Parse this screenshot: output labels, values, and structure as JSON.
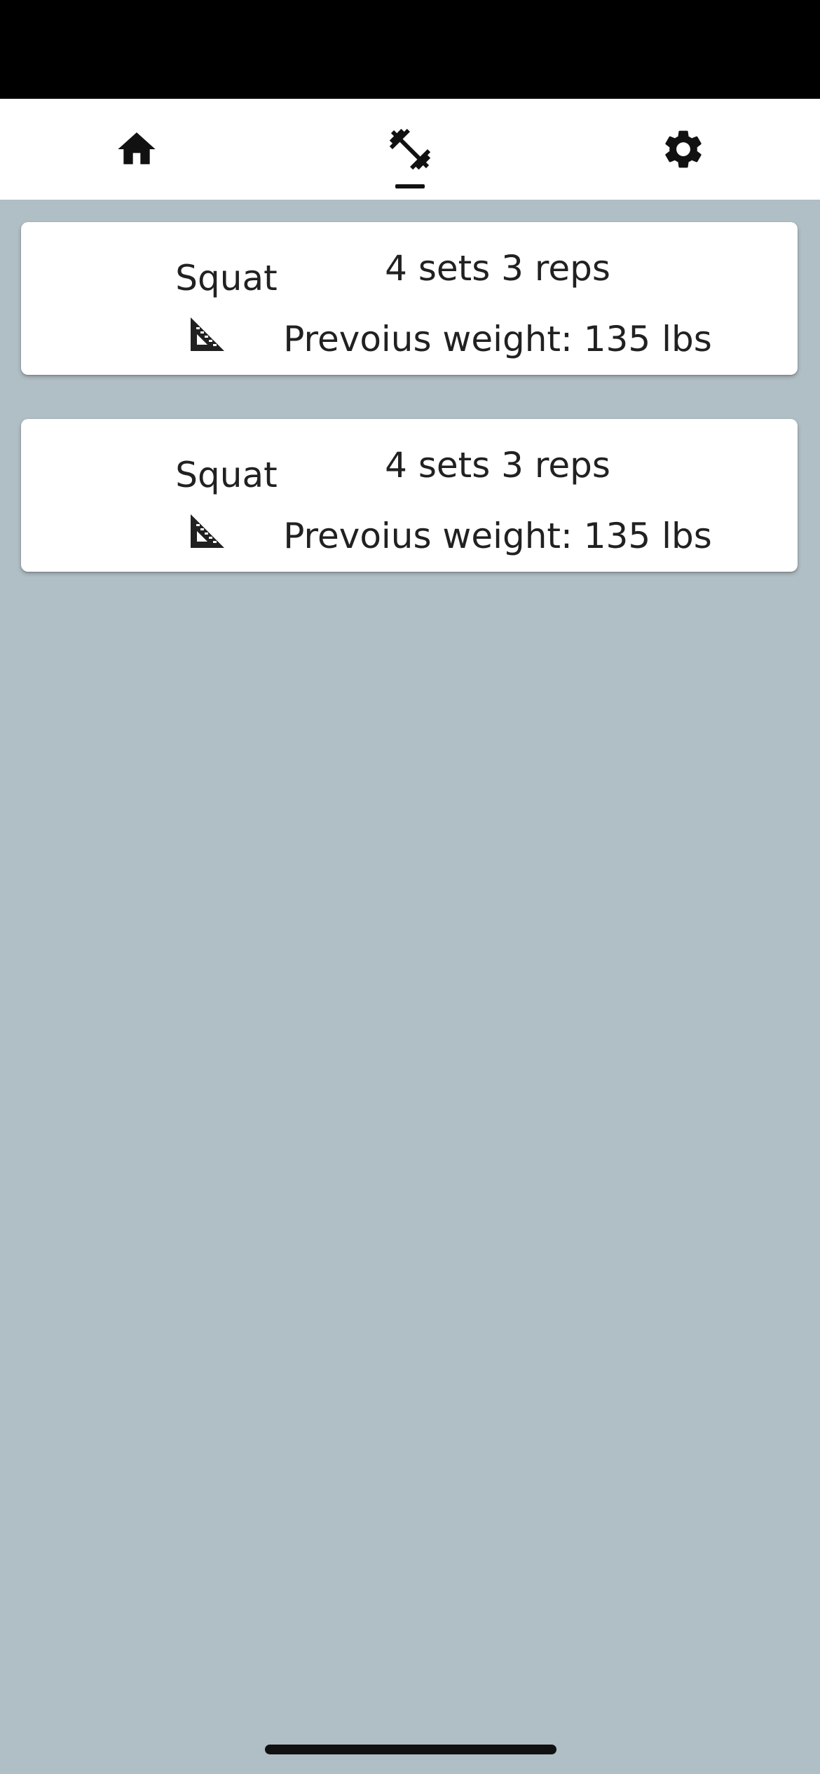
{
  "nav": {
    "items": [
      {
        "name": "home",
        "icon": "home-icon",
        "active": false
      },
      {
        "name": "workout",
        "icon": "dumbbell-icon",
        "active": true
      },
      {
        "name": "settings",
        "icon": "gear-icon",
        "active": false
      }
    ]
  },
  "exercises": [
    {
      "name": "Squat",
      "sets_reps": "4 sets 3 reps",
      "previous_weight": "Prevoius weight: 135 lbs",
      "icon": "set-square-ruler-icon"
    },
    {
      "name": "Squat",
      "sets_reps": "4 sets 3 reps",
      "previous_weight": "Prevoius weight: 135 lbs",
      "icon": "set-square-ruler-icon"
    }
  ],
  "colors": {
    "background": "#b0bec5",
    "status_bar": "#000000",
    "nav_bar": "#ffffff",
    "card": "#ffffff",
    "text": "#212121"
  }
}
